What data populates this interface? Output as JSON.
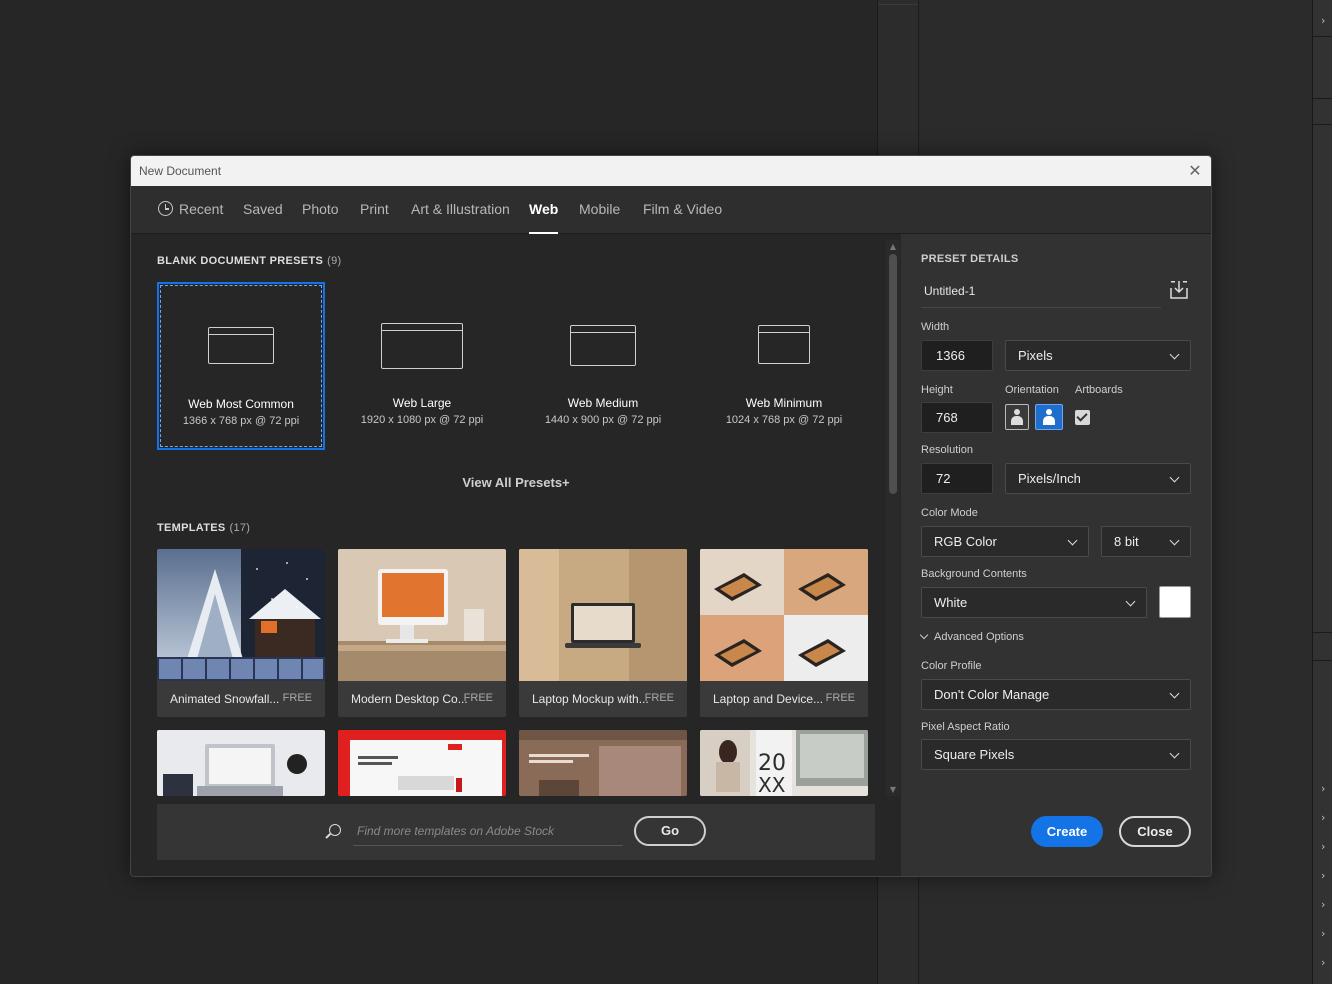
{
  "dialog": {
    "title": "New Document",
    "tabs": [
      {
        "label": "Recent"
      },
      {
        "label": "Saved"
      },
      {
        "label": "Photo"
      },
      {
        "label": "Print"
      },
      {
        "label": "Art & Illustration"
      },
      {
        "label": "Web"
      },
      {
        "label": "Mobile"
      },
      {
        "label": "Film & Video"
      }
    ],
    "active_tab": "Web"
  },
  "presets": {
    "title": "BLANK DOCUMENT PRESETS",
    "count": "(9)",
    "items": [
      {
        "name": "Web Most Common",
        "dims": "1366 x 768 px @ 72 ppi",
        "selected": true
      },
      {
        "name": "Web Large",
        "dims": "1920 x 1080 px @ 72 ppi"
      },
      {
        "name": "Web Medium",
        "dims": "1440 x 900 px @ 72 ppi"
      },
      {
        "name": "Web Minimum",
        "dims": "1024 x 768 px @ 72 ppi"
      }
    ],
    "view_all": "View All Presets+"
  },
  "templates": {
    "title": "TEMPLATES",
    "count": "(17)",
    "items": [
      {
        "name": "Animated Snowfall...",
        "price": "FREE"
      },
      {
        "name": "Modern Desktop Co...",
        "price": "FREE"
      },
      {
        "name": "Laptop Mockup with...",
        "price": "FREE"
      },
      {
        "name": "Laptop and Device...",
        "price": "FREE"
      }
    ],
    "search_placeholder": "Find more templates on Adobe Stock",
    "go_label": "Go"
  },
  "details": {
    "title": "PRESET DETAILS",
    "doc_name": "Untitled-1",
    "width_label": "Width",
    "width_value": "1366",
    "width_unit": "Pixels",
    "height_label": "Height",
    "height_value": "768",
    "orientation_label": "Orientation",
    "artboards_label": "Artboards",
    "artboards_checked": true,
    "resolution_label": "Resolution",
    "resolution_value": "72",
    "resolution_unit": "Pixels/Inch",
    "color_mode_label": "Color Mode",
    "color_mode": "RGB Color",
    "bit_depth": "8 bit",
    "bg_label": "Background Contents",
    "bg_value": "White",
    "bg_color": "#ffffff",
    "advanced_label": "Advanced Options",
    "profile_label": "Color Profile",
    "profile_value": "Don't Color Manage",
    "par_label": "Pixel Aspect Ratio",
    "par_value": "Square Pixels",
    "create_label": "Create",
    "close_label": "Close"
  },
  "colors": {
    "accent": "#1473e6"
  }
}
